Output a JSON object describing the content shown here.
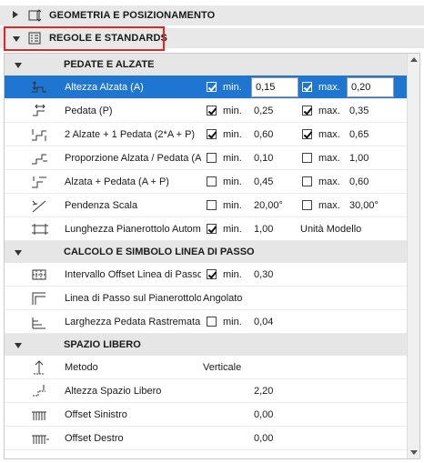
{
  "sections": [
    {
      "label": "GEOMETRIA E POSIZIONAMENTO",
      "expanded": false
    },
    {
      "label": "REGOLE E STANDARDS",
      "expanded": true
    }
  ],
  "groups": [
    {
      "title": "PEDATE E ALZATE",
      "rows": [
        {
          "name": "Altezza Alzata (A)",
          "min_checked": true,
          "min_label": "min.",
          "min_value": "0,15",
          "max_checked": true,
          "max_label": "max.",
          "max_value": "0,20",
          "selected": true
        },
        {
          "name": "Pedata (P)",
          "min_checked": true,
          "min_label": "min.",
          "min_value": "0,25",
          "max_checked": true,
          "max_label": "max.",
          "max_value": "0,35"
        },
        {
          "name": "2 Alzate + 1 Pedata (2*A + P)",
          "min_checked": true,
          "min_label": "min.",
          "min_value": "0,60",
          "max_checked": true,
          "max_label": "max.",
          "max_value": "0,65"
        },
        {
          "name": "Proporzione Alzata / Pedata (A / P)",
          "min_checked": false,
          "min_label": "min.",
          "min_value": "0,10",
          "max_checked": false,
          "max_label": "max.",
          "max_value": "1,00"
        },
        {
          "name": "Alzata + Pedata (A + P)",
          "min_checked": false,
          "min_label": "min.",
          "min_value": "0,45",
          "max_checked": false,
          "max_label": "max.",
          "max_value": "0,60"
        },
        {
          "name": "Pendenza Scala",
          "min_checked": false,
          "min_label": "min.",
          "min_value": "20,00°",
          "max_checked": false,
          "max_label": "max.",
          "max_value": "30,00°"
        },
        {
          "name": "Lunghezza Pianerottolo Automatico",
          "min_checked": true,
          "min_label": "min.",
          "min_value": "1,00",
          "extra": "Unità Modello"
        }
      ]
    },
    {
      "title": "CALCOLO E SIMBOLO LINEA DI PASSO",
      "rows": [
        {
          "name": "Intervallo Offset Linea di Passo",
          "min_checked": true,
          "min_label": "min.",
          "min_value": "0,30"
        },
        {
          "name": "Linea di Passo sul Pianerottolo",
          "text_value": "Angolato"
        },
        {
          "name": "Larghezza Pedata Rastremata",
          "min_checked": false,
          "min_label": "min.",
          "min_value": "0,04"
        }
      ]
    },
    {
      "title": "SPAZIO LIBERO",
      "rows": [
        {
          "name": "Metodo",
          "text_value": "Verticale"
        },
        {
          "name": "Altezza Spazio Libero",
          "value": "2,20"
        },
        {
          "name": "Offset Sinistro",
          "value": "0,00"
        },
        {
          "name": "Offset Destro",
          "value": "0,00"
        }
      ]
    }
  ]
}
